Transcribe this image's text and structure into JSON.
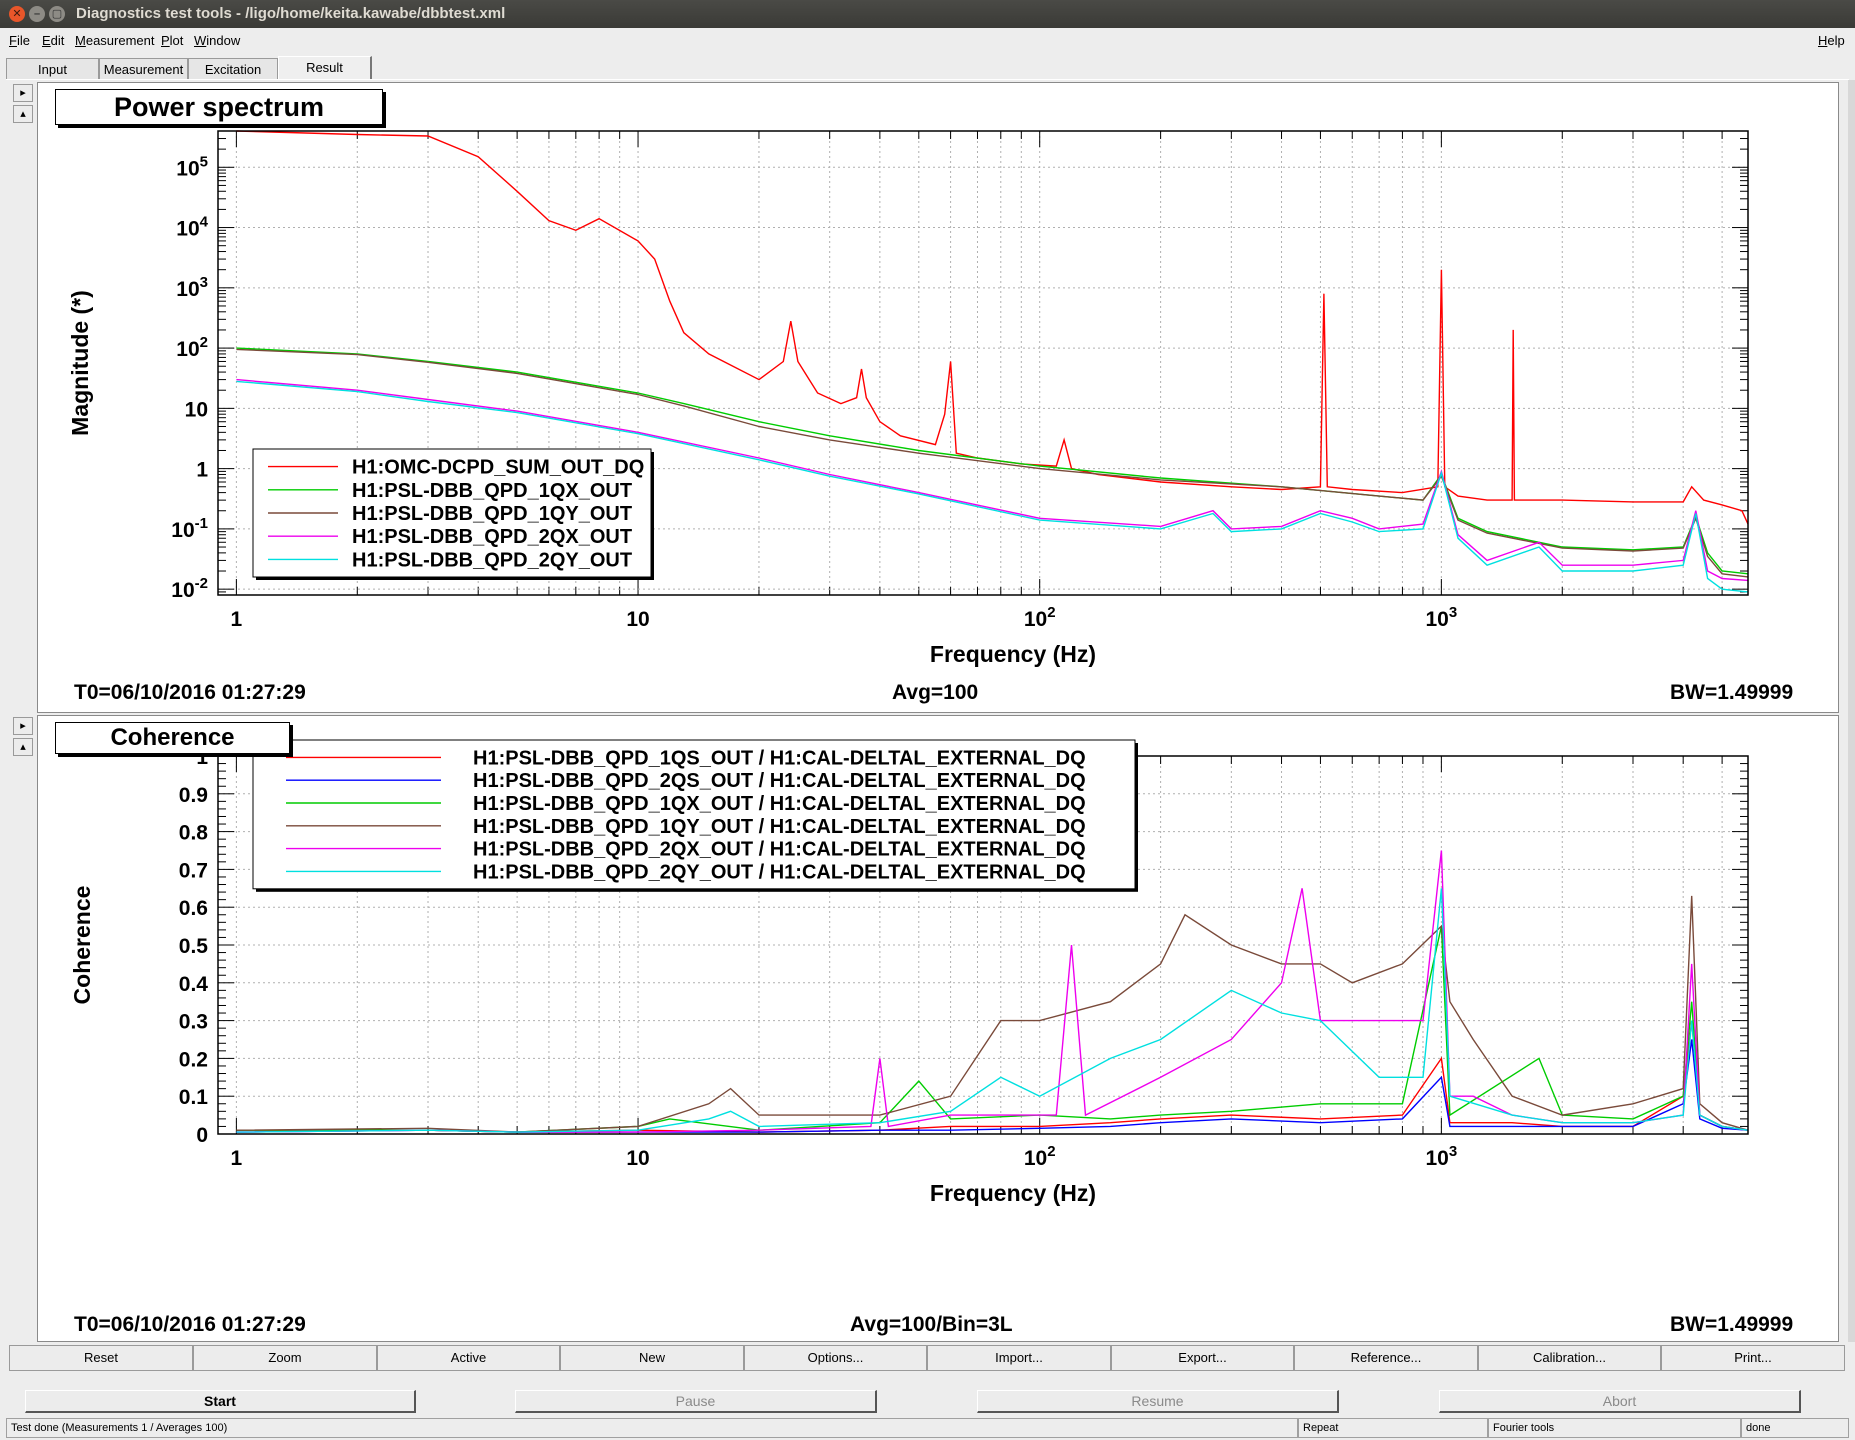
{
  "window": {
    "title": "Diagnostics test tools - /ligo/home/keita.kawabe/dbbtest.xml"
  },
  "menu": {
    "items": [
      "File",
      "Edit",
      "Measurement",
      "Plot",
      "Window"
    ],
    "help": "Help"
  },
  "tabs": [
    "Input",
    "Measurement",
    "Excitation",
    "Result"
  ],
  "active_tab": "Result",
  "pad_buttons": {
    "arrow_right": "▸",
    "arrow_up": "▴"
  },
  "power": {
    "title_box": "Power spectrum",
    "t0": "T0=06/10/2016 01:27:29",
    "avg": "Avg=100",
    "bw": "BW=1.49999"
  },
  "coherence": {
    "title_box": "Coherence",
    "t0": "T0=06/10/2016 01:27:29",
    "avg": "Avg=100/Bin=3L",
    "bw": "BW=1.49999"
  },
  "buttons": [
    "Reset",
    "Zoom",
    "Active",
    "New",
    "Options...",
    "Import...",
    "Export...",
    "Reference...",
    "Calibration...",
    "Print..."
  ],
  "run_buttons": {
    "start": "Start",
    "pause": "Pause",
    "resume": "Resume",
    "abort": "Abort"
  },
  "status": {
    "text": "Test done (Measurements 1 / Averages 100)",
    "repeat": "Repeat",
    "fourier": "Fourier tools",
    "done": "done"
  },
  "chart_data": [
    {
      "type": "line",
      "title": "",
      "xlabel": "Frequency (Hz)",
      "ylabel": "Magnitude (*)",
      "xscale": "log",
      "yscale": "log",
      "xlim": [
        0.9,
        5800
      ],
      "ylim": [
        0.008,
        400000
      ],
      "x_ticks": [
        {
          "v": 1,
          "label": "1"
        },
        {
          "v": 10,
          "label": "10"
        },
        {
          "v": 100,
          "label": "10",
          "sup": "2"
        },
        {
          "v": 1000,
          "label": "10",
          "sup": "3"
        }
      ],
      "y_ticks": [
        {
          "v": 0.01,
          "label": "10",
          "sup": "-2"
        },
        {
          "v": 0.1,
          "label": "10",
          "sup": "-1"
        },
        {
          "v": 1,
          "label": "1"
        },
        {
          "v": 10,
          "label": "10"
        },
        {
          "v": 100,
          "label": "10",
          "sup": "2"
        },
        {
          "v": 1000,
          "label": "10",
          "sup": "3"
        },
        {
          "v": 10000,
          "label": "10",
          "sup": "4"
        },
        {
          "v": 100000,
          "label": "10",
          "sup": "5"
        }
      ],
      "grid": true,
      "legend_position": "bottom-left",
      "series": [
        {
          "name": "H1:OMC-DCPD_SUM_OUT_DQ",
          "color": "#ff0000",
          "x": [
            1,
            2,
            3,
            4,
            5,
            6,
            7,
            8,
            10,
            11,
            12,
            13,
            15,
            20,
            23,
            24,
            25,
            28,
            32,
            35,
            36,
            37,
            40,
            45,
            55,
            58,
            60,
            62,
            70,
            90,
            110,
            115,
            120,
            140,
            200,
            300,
            400,
            500,
            510,
            520,
            600,
            800,
            980,
            1000,
            1020,
            1100,
            1300,
            1500,
            1510,
            1520,
            1800,
            2000,
            3000,
            4000,
            4200,
            4500,
            5000,
            5600,
            5800
          ],
          "y": [
            400000,
            350000,
            330000,
            150000,
            40000,
            13000,
            9000,
            14000,
            6000,
            3000,
            600,
            180,
            80,
            30,
            60,
            280,
            60,
            18,
            12,
            15,
            45,
            15,
            6,
            3.5,
            2.5,
            8,
            60,
            1.8,
            1.5,
            1.2,
            1.1,
            3,
            1,
            0.8,
            0.6,
            0.5,
            0.45,
            0.5,
            800,
            0.5,
            0.45,
            0.4,
            0.5,
            2000,
            0.5,
            0.35,
            0.3,
            0.3,
            200,
            0.3,
            0.3,
            0.3,
            0.28,
            0.28,
            0.5,
            0.3,
            0.25,
            0.2,
            0.12
          ]
        },
        {
          "name": "H1:PSL-DBB_QPD_1QX_OUT",
          "color": "#00cc00",
          "x": [
            1,
            2,
            3,
            5,
            10,
            13,
            20,
            30,
            50,
            100,
            200,
            400,
            700,
            900,
            1000,
            1100,
            1300,
            2000,
            3000,
            4000,
            4300,
            4600,
            5000,
            5800
          ],
          "y": [
            100,
            80,
            60,
            40,
            18,
            12,
            6,
            3.5,
            2,
            1.1,
            0.7,
            0.5,
            0.35,
            0.3,
            0.8,
            0.15,
            0.09,
            0.05,
            0.045,
            0.05,
            0.16,
            0.04,
            0.02,
            0.018
          ]
        },
        {
          "name": "H1:PSL-DBB_QPD_1QY_OUT",
          "color": "#7a4a3a",
          "x": [
            1,
            2,
            3,
            5,
            10,
            13,
            20,
            30,
            50,
            100,
            200,
            400,
            700,
            900,
            1000,
            1100,
            1300,
            2000,
            3000,
            4000,
            4300,
            4600,
            5000,
            5800
          ],
          "y": [
            95,
            78,
            58,
            38,
            17,
            11,
            5,
            3,
            1.8,
            1,
            0.65,
            0.5,
            0.35,
            0.3,
            0.75,
            0.14,
            0.085,
            0.048,
            0.043,
            0.048,
            0.15,
            0.035,
            0.018,
            0.016
          ]
        },
        {
          "name": "H1:PSL-DBB_QPD_2QX_OUT",
          "color": "#ee00ee",
          "x": [
            1,
            2,
            3,
            5,
            10,
            20,
            30,
            50,
            100,
            200,
            270,
            300,
            400,
            500,
            600,
            700,
            900,
            1000,
            1100,
            1300,
            1750,
            2000,
            3000,
            4000,
            4300,
            4600,
            5000,
            5800
          ],
          "y": [
            30,
            20,
            14,
            9,
            4,
            1.5,
            0.8,
            0.4,
            0.15,
            0.11,
            0.2,
            0.1,
            0.11,
            0.2,
            0.15,
            0.1,
            0.12,
            0.9,
            0.08,
            0.03,
            0.06,
            0.025,
            0.025,
            0.03,
            0.2,
            0.02,
            0.015,
            0.014
          ]
        },
        {
          "name": "H1:PSL-DBB_QPD_2QY_OUT",
          "color": "#00e0e0",
          "x": [
            1,
            2,
            3,
            5,
            10,
            20,
            30,
            50,
            100,
            200,
            270,
            300,
            400,
            500,
            600,
            700,
            900,
            1000,
            1100,
            1300,
            1750,
            2000,
            3000,
            4000,
            4300,
            4600,
            5000,
            5800
          ],
          "y": [
            28,
            19,
            13,
            8.5,
            3.8,
            1.4,
            0.75,
            0.38,
            0.14,
            0.1,
            0.18,
            0.09,
            0.1,
            0.18,
            0.13,
            0.09,
            0.1,
            0.85,
            0.07,
            0.025,
            0.05,
            0.02,
            0.02,
            0.025,
            0.18,
            0.015,
            0.01,
            0.009
          ]
        }
      ]
    },
    {
      "type": "line",
      "title": "",
      "xlabel": "Frequency (Hz)",
      "ylabel": "Coherence",
      "xscale": "log",
      "yscale": "linear",
      "xlim": [
        0.9,
        5800
      ],
      "ylim": [
        0,
        1
      ],
      "x_ticks": [
        {
          "v": 1,
          "label": "1"
        },
        {
          "v": 10,
          "label": "10"
        },
        {
          "v": 100,
          "label": "10",
          "sup": "2"
        },
        {
          "v": 1000,
          "label": "10",
          "sup": "3"
        }
      ],
      "y_ticks": [
        {
          "v": 0,
          "label": "0"
        },
        {
          "v": 0.1,
          "label": "0.1"
        },
        {
          "v": 0.2,
          "label": "0.2"
        },
        {
          "v": 0.3,
          "label": "0.3"
        },
        {
          "v": 0.4,
          "label": "0.4"
        },
        {
          "v": 0.5,
          "label": "0.5"
        },
        {
          "v": 0.6,
          "label": "0.6"
        },
        {
          "v": 0.7,
          "label": "0.7"
        },
        {
          "v": 0.8,
          "label": "0.8"
        },
        {
          "v": 0.9,
          "label": "0.9"
        },
        {
          "v": 1,
          "label": "1"
        }
      ],
      "grid": true,
      "legend_position": "top-left",
      "series": [
        {
          "name": "H1:PSL-DBB_QPD_1QS_OUT / H1:CAL-DELTAL_EXTERNAL_DQ",
          "color": "#ff0000",
          "x": [
            1,
            3,
            5,
            10,
            20,
            40,
            60,
            100,
            150,
            200,
            300,
            500,
            800,
            1000,
            1050,
            1500,
            2000,
            3000,
            4000,
            4200,
            4400,
            5000,
            5800
          ],
          "y": [
            0.01,
            0.01,
            0.005,
            0.01,
            0.005,
            0.01,
            0.02,
            0.02,
            0.03,
            0.04,
            0.05,
            0.04,
            0.05,
            0.2,
            0.03,
            0.03,
            0.02,
            0.02,
            0.1,
            0.3,
            0.05,
            0.02,
            0.01
          ]
        },
        {
          "name": "H1:PSL-DBB_QPD_2QS_OUT / H1:CAL-DELTAL_EXTERNAL_DQ",
          "color": "#0000ff",
          "x": [
            1,
            3,
            5,
            10,
            20,
            40,
            60,
            100,
            150,
            200,
            300,
            500,
            800,
            1000,
            1050,
            1500,
            2000,
            3000,
            4000,
            4200,
            4400,
            5000,
            5800
          ],
          "y": [
            0.005,
            0.01,
            0.005,
            0.005,
            0.005,
            0.01,
            0.01,
            0.015,
            0.02,
            0.03,
            0.04,
            0.03,
            0.04,
            0.15,
            0.02,
            0.02,
            0.02,
            0.02,
            0.08,
            0.25,
            0.04,
            0.015,
            0.01
          ]
        },
        {
          "name": "H1:PSL-DBB_QPD_1QX_OUT / H1:CAL-DELTAL_EXTERNAL_DQ",
          "color": "#00cc00",
          "x": [
            1,
            3,
            5,
            10,
            12,
            20,
            40,
            50,
            60,
            100,
            150,
            200,
            300,
            500,
            800,
            1000,
            1050,
            1750,
            2000,
            3000,
            4000,
            4200,
            4400,
            5000,
            5800
          ],
          "y": [
            0.01,
            0.01,
            0.005,
            0.02,
            0.04,
            0.01,
            0.03,
            0.14,
            0.04,
            0.05,
            0.04,
            0.05,
            0.06,
            0.08,
            0.08,
            0.55,
            0.05,
            0.2,
            0.05,
            0.04,
            0.1,
            0.35,
            0.05,
            0.02,
            0.01
          ]
        },
        {
          "name": "H1:PSL-DBB_QPD_1QY_OUT / H1:CAL-DELTAL_EXTERNAL_DQ",
          "color": "#7a4a3a",
          "x": [
            1,
            3,
            5,
            10,
            15,
            17,
            20,
            40,
            60,
            80,
            100,
            150,
            200,
            230,
            300,
            400,
            500,
            600,
            800,
            1000,
            1050,
            1200,
            1500,
            2000,
            3000,
            4000,
            4200,
            4400,
            5000,
            5800
          ],
          "y": [
            0.01,
            0.015,
            0.005,
            0.02,
            0.08,
            0.12,
            0.05,
            0.05,
            0.1,
            0.3,
            0.3,
            0.35,
            0.45,
            0.58,
            0.5,
            0.45,
            0.45,
            0.4,
            0.45,
            0.55,
            0.35,
            0.25,
            0.1,
            0.05,
            0.08,
            0.12,
            0.63,
            0.08,
            0.03,
            0.01
          ]
        },
        {
          "name": "H1:PSL-DBB_QPD_2QX_OUT / H1:CAL-DELTAL_EXTERNAL_DQ",
          "color": "#ee00ee",
          "x": [
            1,
            3,
            5,
            10,
            20,
            38,
            40,
            42,
            60,
            110,
            120,
            130,
            200,
            300,
            400,
            450,
            500,
            700,
            900,
            1000,
            1050,
            1200,
            1500,
            2000,
            3000,
            4000,
            4200,
            4400,
            5000,
            5800
          ],
          "y": [
            0.005,
            0.01,
            0.005,
            0.005,
            0.01,
            0.02,
            0.2,
            0.02,
            0.05,
            0.05,
            0.5,
            0.05,
            0.15,
            0.25,
            0.4,
            0.65,
            0.3,
            0.3,
            0.3,
            0.75,
            0.1,
            0.1,
            0.05,
            0.03,
            0.03,
            0.05,
            0.45,
            0.05,
            0.02,
            0.01
          ]
        },
        {
          "name": "H1:PSL-DBB_QPD_2QY_OUT / H1:CAL-DELTAL_EXTERNAL_DQ",
          "color": "#00e0e0",
          "x": [
            1,
            3,
            5,
            10,
            15,
            17,
            20,
            40,
            60,
            80,
            100,
            150,
            200,
            300,
            400,
            500,
            700,
            900,
            1000,
            1050,
            1500,
            2000,
            3000,
            4000,
            4200,
            4400,
            5000,
            5800
          ],
          "y": [
            0.005,
            0.01,
            0.005,
            0.01,
            0.04,
            0.06,
            0.02,
            0.03,
            0.06,
            0.15,
            0.1,
            0.2,
            0.25,
            0.38,
            0.32,
            0.3,
            0.15,
            0.15,
            0.65,
            0.1,
            0.05,
            0.03,
            0.03,
            0.05,
            0.3,
            0.05,
            0.02,
            0.01
          ]
        }
      ]
    }
  ]
}
